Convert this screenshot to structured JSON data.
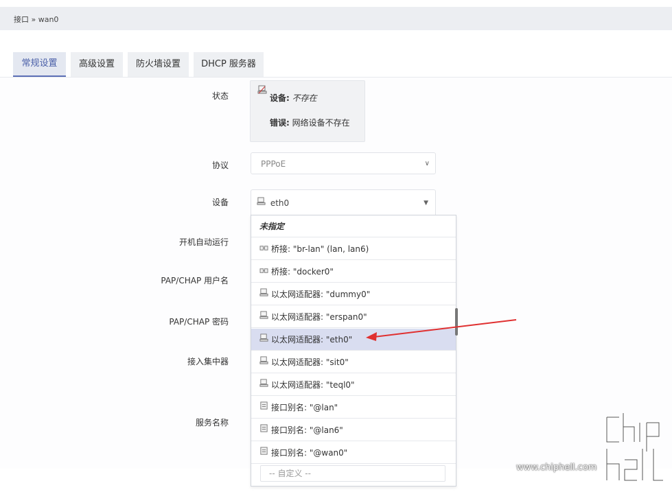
{
  "breadcrumb": "接口 » wan0",
  "tabs": [
    {
      "label": "常规设置",
      "active": true
    },
    {
      "label": "高级设置",
      "active": false
    },
    {
      "label": "防火墙设置",
      "active": false
    },
    {
      "label": "DHCP 服务器",
      "active": false
    }
  ],
  "form": {
    "status_label": "状态",
    "status": {
      "device_key": "设备:",
      "device_value": "不存在",
      "error_key": "错误:",
      "error_value": "网络设备不存在"
    },
    "protocol_label": "协议",
    "protocol_value": "PPPoE",
    "device_label": "设备",
    "device_value": "eth0",
    "autostart_label": "开机自动运行",
    "username_label": "PAP/CHAP 用户名",
    "password_label": "PAP/CHAP 密码",
    "ac_label": "接入集中器",
    "service_label": "服务名称"
  },
  "dropdown": {
    "items": [
      {
        "label": "未指定",
        "icon": "",
        "selected": false,
        "header": true
      },
      {
        "label": "桥接: \"br-lan\" (lan, lan6)",
        "icon": "bridge-icon",
        "selected": false
      },
      {
        "label": "桥接: \"docker0\"",
        "icon": "bridge-icon",
        "selected": false
      },
      {
        "label": "以太网适配器: \"dummy0\"",
        "icon": "ethernet-icon",
        "selected": false
      },
      {
        "label": "以太网适配器: \"erspan0\"",
        "icon": "ethernet-icon",
        "selected": false
      },
      {
        "label": "以太网适配器: \"eth0\"",
        "icon": "ethernet-icon",
        "selected": true
      },
      {
        "label": "以太网适配器: \"sit0\"",
        "icon": "ethernet-icon",
        "selected": false
      },
      {
        "label": "以太网适配器: \"teql0\"",
        "icon": "ethernet-icon",
        "selected": false
      },
      {
        "label": "接口别名: \"@lan\"",
        "icon": "alias-icon",
        "selected": false
      },
      {
        "label": "接口别名: \"@lan6\"",
        "icon": "alias-icon",
        "selected": false
      },
      {
        "label": "接口别名: \"@wan0\"",
        "icon": "alias-icon",
        "selected": false
      }
    ],
    "custom_placeholder": "-- 自定义 --"
  },
  "watermark": {
    "site": "www.chiphell.com",
    "logo_text": "chip hell"
  },
  "colors": {
    "accent": "#5b6fb5",
    "arrow": "#e03030",
    "selected_bg": "#d9ddf0"
  }
}
